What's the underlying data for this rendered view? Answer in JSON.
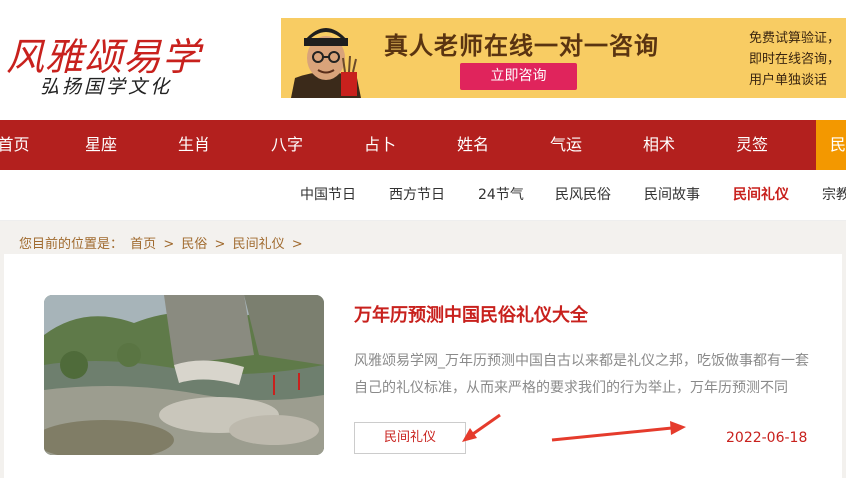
{
  "logo": {
    "title": "风雅颂易学",
    "subtitle": "弘扬国学文化"
  },
  "banner": {
    "headline": "真人老师在线一对一咨询",
    "button": "立即咨询",
    "side_lines": [
      "免费试算验证，",
      "即时在线咨询，",
      "用户单独谈话"
    ]
  },
  "nav": {
    "items": [
      "首页",
      "星座",
      "生肖",
      "八字",
      "占卜",
      "姓名",
      "气运",
      "相术",
      "灵签",
      "民"
    ],
    "active_index": 9
  },
  "subnav": {
    "items": [
      "中国节日",
      "西方节日",
      "24节气",
      "民风民俗",
      "民间故事",
      "民间礼仪",
      "宗教"
    ],
    "active_index": 5
  },
  "breadcrumb": {
    "prefix": "您目前的位置是：",
    "items": [
      "首页",
      ">",
      "民俗",
      ">",
      "民间礼仪",
      ">"
    ]
  },
  "article": {
    "title": "万年历预测中国民俗礼仪大全",
    "excerpt": "风雅颂易学网_万年历预测中国自古以来都是礼仪之邦，吃饭做事都有一套自己的礼仪标准，从而来严格的要求我们的行为举止，万年历预测不同",
    "tag": "民间礼仪",
    "date": "2022-06-18"
  },
  "colors": {
    "brand_red": "#b3201e",
    "accent_orange": "#f39800",
    "banner_yellow": "#f8cc63",
    "button_pink": "#e0245c"
  }
}
